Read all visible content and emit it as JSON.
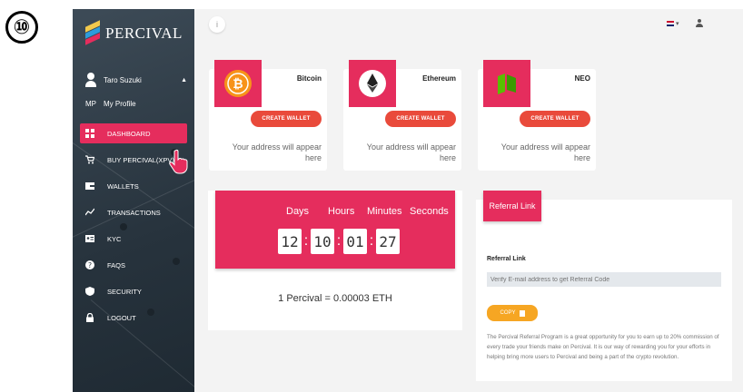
{
  "step_badge": "⑩",
  "sidebar": {
    "brand": "PERCIVAL",
    "user_name": "Taro Suzuki",
    "profile_initials": "MP",
    "profile_label": "My Profile",
    "items": [
      {
        "label": "DASHBOARD",
        "icon": "dashboard-icon"
      },
      {
        "label": "BUY PERCIVAL(XPV)",
        "icon": "cart-icon"
      },
      {
        "label": "WALLETS",
        "icon": "wallet-icon"
      },
      {
        "label": "TRANSACTIONS",
        "icon": "chart-line-icon"
      },
      {
        "label": "KYC",
        "icon": "id-card-icon"
      },
      {
        "label": "FAQS",
        "icon": "question-icon"
      },
      {
        "label": "SECURITY",
        "icon": "shield-icon"
      },
      {
        "label": "LOGOUT",
        "icon": "lock-icon"
      }
    ]
  },
  "topbar": {
    "info": "i"
  },
  "coins": [
    {
      "name": "Bitcoin",
      "button": "CREATE WALLET",
      "address": "Your address will appear here"
    },
    {
      "name": "Ethereum",
      "button": "CREATE WALLET",
      "address": "Your address will appear here"
    },
    {
      "name": "NEO",
      "button": "CREATE WALLET",
      "address": "Your address will appear here"
    }
  ],
  "countdown": {
    "labels": [
      "Days",
      "Hours",
      "Minutes",
      "Seconds"
    ],
    "days": "12",
    "hours": "10",
    "minutes": "01",
    "seconds": "27",
    "rate": "1 Percival = 0.00003 ETH"
  },
  "referral": {
    "tab": "Referral Link",
    "label": "Referral Link",
    "placeholder": "Verify E-mail address to get Referral Code",
    "copy": "COPY",
    "description": "The Percival Referral Program is a great opportunity for you to earn up to 20% commission of every trade your friends make on Percival. It is our way of rewarding you for your efforts in helping bring more users to Percival and being a part of the crypto revolution."
  },
  "colors": {
    "accent": "#e52d5d",
    "button": "#e94a3b",
    "copy": "#f6a623"
  }
}
